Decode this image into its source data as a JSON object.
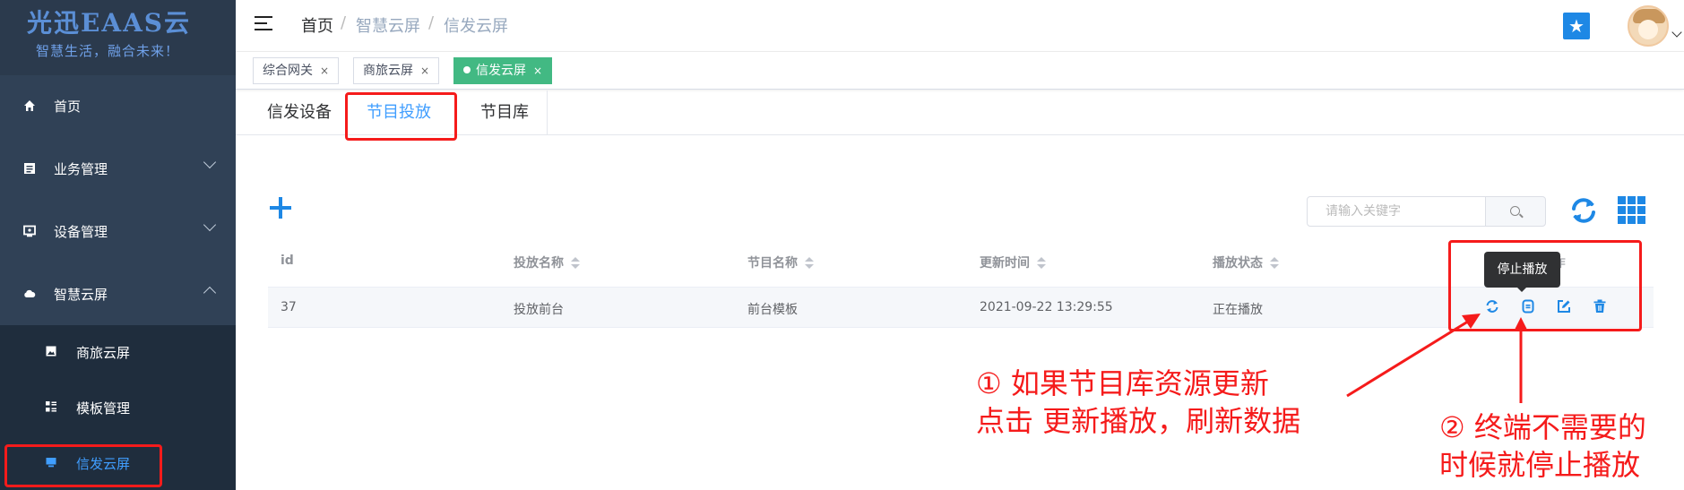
{
  "logo": {
    "title": "光迅EAAS云",
    "subtitle": "智慧生活，融合未来！"
  },
  "sidebar": {
    "items": [
      {
        "label": "首页",
        "icon": "home-icon"
      },
      {
        "label": "业务管理",
        "icon": "document-icon"
      },
      {
        "label": "设备管理",
        "icon": "monitor-icon"
      },
      {
        "label": "智慧云屏",
        "icon": "cloud-icon"
      }
    ],
    "submenu": [
      {
        "label": "商旅云屏",
        "icon": "image-icon"
      },
      {
        "label": "模板管理",
        "icon": "template-icon"
      },
      {
        "label": "信发云屏",
        "icon": "screen-icon"
      }
    ]
  },
  "breadcrumb": {
    "items": [
      "首页",
      "智慧云屏",
      "信发云屏"
    ],
    "separator": "/"
  },
  "tags": [
    {
      "label": "综合网关",
      "close": "×"
    },
    {
      "label": "商旅云屏",
      "close": "×"
    },
    {
      "label": "信发云屏",
      "close": "×"
    }
  ],
  "tabs": [
    "信发设备",
    "节目投放",
    "节目库"
  ],
  "search": {
    "placeholder": "请输入关键字"
  },
  "table": {
    "headers": [
      "id",
      "投放名称",
      "节目名称",
      "更新时间",
      "播放状态"
    ],
    "rows": [
      {
        "id": "37",
        "name": "投放前台",
        "program": "前台模板",
        "updated": "2021-09-22 13:29:55",
        "status": "正在播放"
      }
    ]
  },
  "tooltip": {
    "text": "停止播放"
  },
  "annotations": {
    "note1_line1": "① 如果节目库资源更新",
    "note1_line2": "点击 更新播放，刷新数据",
    "note2_line1": "② 终端不需要的",
    "note2_line2": "时候就停止播放"
  },
  "colors": {
    "sidebar_bg": "#304156",
    "submenu_bg": "#1f2d3d",
    "accent": "#1e88e5",
    "active_tag": "#42b983",
    "annotation": "#f51b1b"
  }
}
